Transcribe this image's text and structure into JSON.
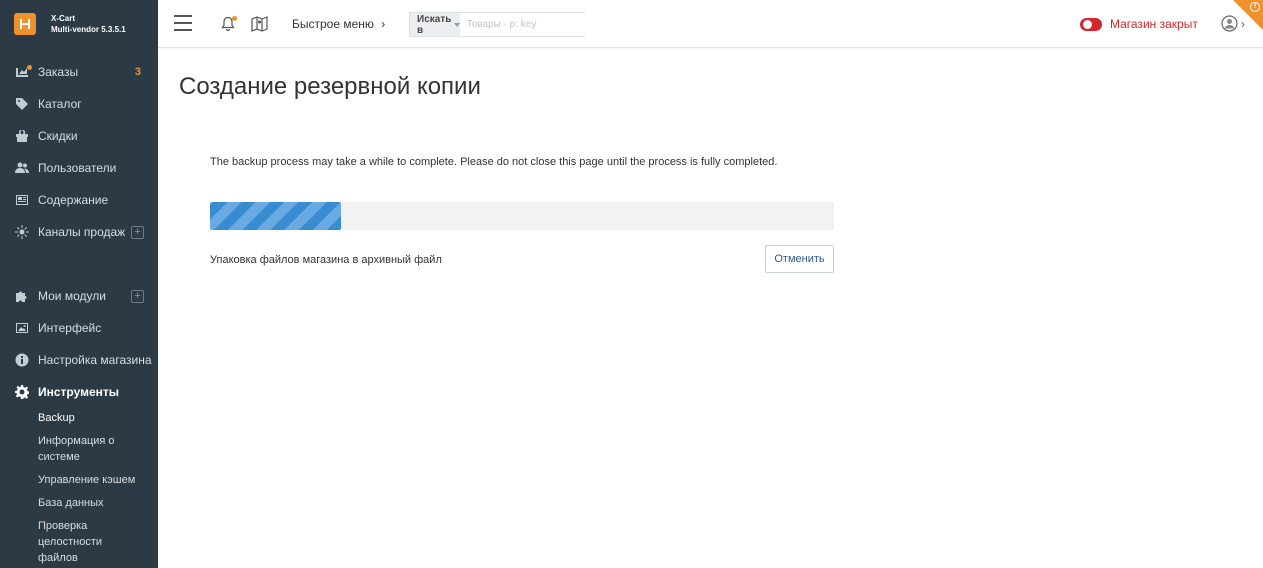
{
  "brand": {
    "name": "X-Cart",
    "version": "Multi-vendor 5.3.5.1"
  },
  "sidebar": {
    "items": [
      {
        "label": "Заказы",
        "icon": "orders-icon",
        "badge": "3"
      },
      {
        "label": "Каталог",
        "icon": "tag-icon"
      },
      {
        "label": "Скидки",
        "icon": "gift-icon"
      },
      {
        "label": "Пользователи",
        "icon": "users-icon"
      },
      {
        "label": "Содержание",
        "icon": "content-icon"
      },
      {
        "label": "Каналы продаж",
        "icon": "sales-channels-icon",
        "plus": true
      },
      {
        "label": "Мои модули",
        "icon": "puzzle-icon",
        "plus": true
      },
      {
        "label": "Интерфейс",
        "icon": "image-icon"
      },
      {
        "label": "Настройка магазина",
        "icon": "info-icon"
      },
      {
        "label": "Инструменты",
        "icon": "gear-icon",
        "active": true
      }
    ],
    "subitems": [
      "Backup",
      "Информация о системе",
      "Управление кэшем",
      "База данных",
      "Проверка целостности файлов"
    ]
  },
  "header": {
    "quick_menu": "Быстрое меню",
    "search_in": "Искать в",
    "search_placeholder": "Товары - p: key",
    "store_status": "Магазин закрыт"
  },
  "main": {
    "title": "Создание резервной копии",
    "notice": "The backup process may take a while to complete. Please do not close this page until the process is fully completed.",
    "progress": 0.21,
    "status": "Упаковка файлов магазина в архивный файл",
    "cancel": "Отменить"
  },
  "colors": {
    "accent": "#f0922b",
    "sidebar": "#2b3a44",
    "danger": "#d3272b",
    "progress": "#3a8cd2"
  }
}
